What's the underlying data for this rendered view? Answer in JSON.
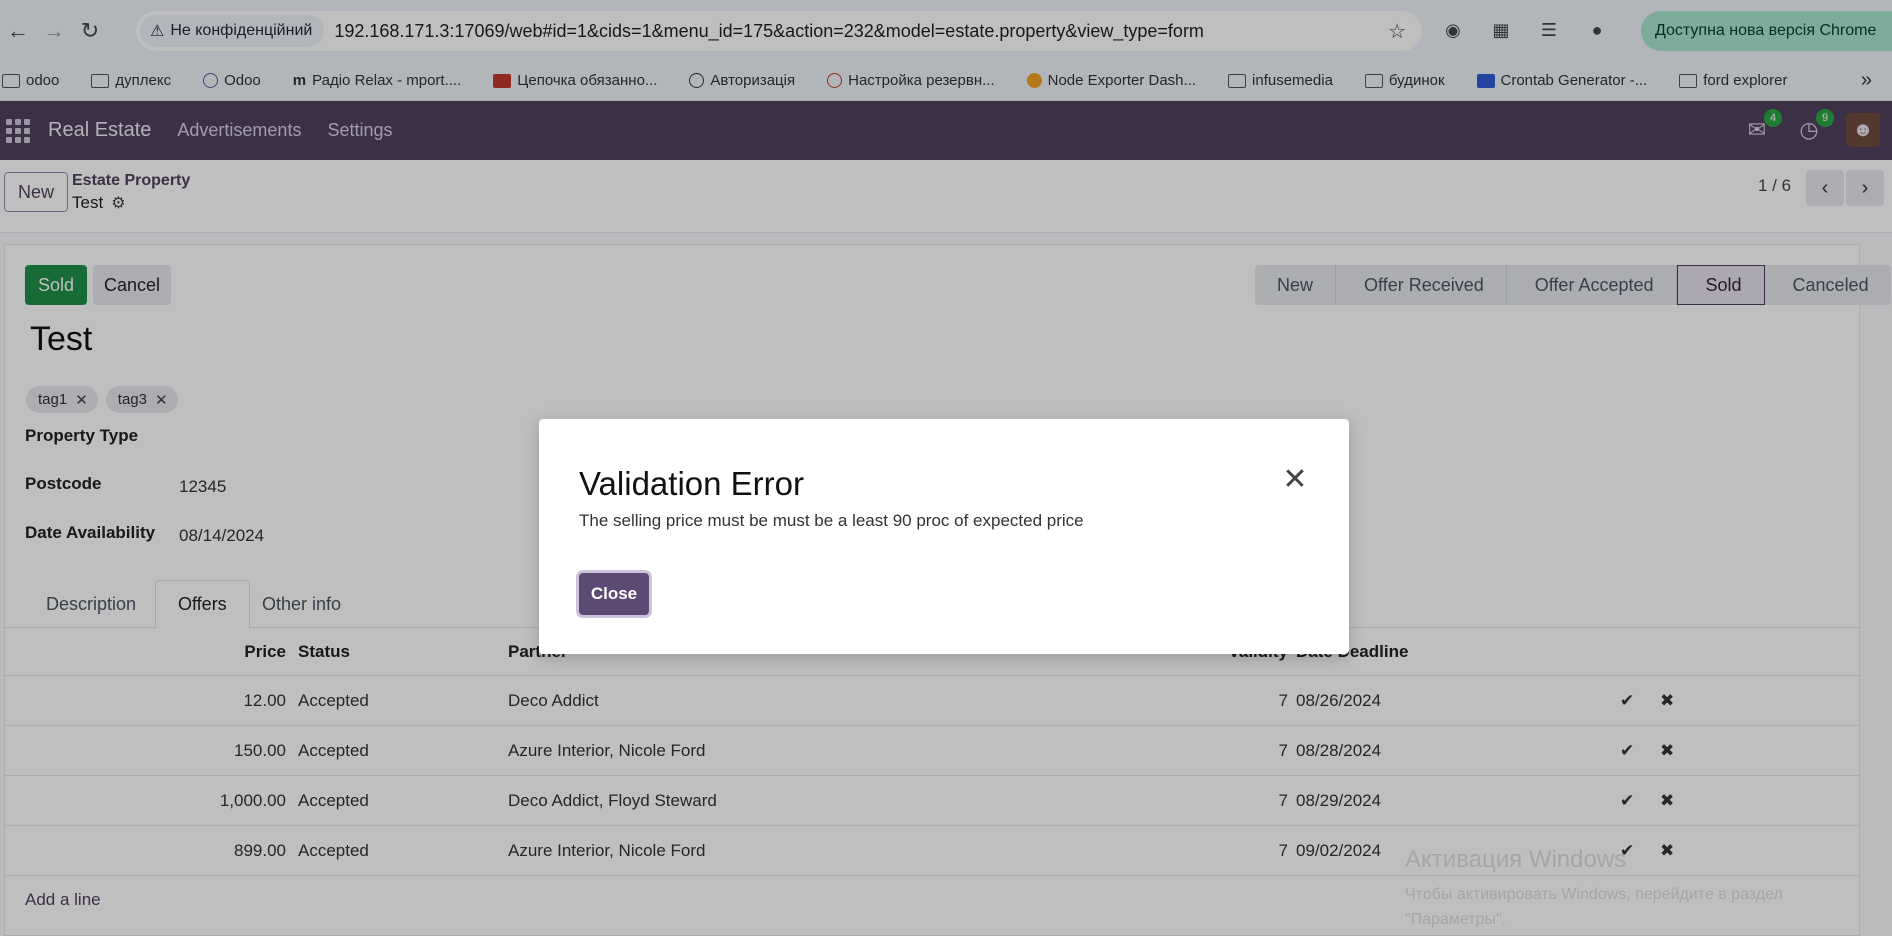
{
  "browser": {
    "security_label": "Не конфіденційний",
    "url": "192.168.171.3:17069/web#id=1&cids=1&menu_id=175&action=232&model=estate.property&view_type=form",
    "update_label": "Доступна нова версія Chrome",
    "bookmarks": [
      "odoo",
      "дуплекс",
      "Odoo",
      "Радіо Relax - mport....",
      "Цепочка обязанно...",
      "Авторизація",
      "Настройка резервн...",
      "Node Exporter Dash...",
      "infusemedia",
      "будинок",
      "Crontab Generator -...",
      "ford explorer"
    ]
  },
  "navbar": {
    "brand": "Real Estate",
    "menu": [
      "Advertisements",
      "Settings"
    ],
    "messages_count": "4",
    "activities_count": "9"
  },
  "control": {
    "new_label": "New",
    "breadcrumb_parent": "Estate Property",
    "breadcrumb_current": "Test",
    "pager": "1 / 6"
  },
  "form": {
    "sold_label": "Sold",
    "cancel_label": "Cancel",
    "stages": [
      "New",
      "Offer Received",
      "Offer Accepted",
      "Sold",
      "Canceled"
    ],
    "current_stage": "Sold",
    "title": "Test",
    "tags": [
      "tag1",
      "tag3"
    ],
    "fields": {
      "property_type_label": "Property Type",
      "postcode_label": "Postcode",
      "postcode_value": "12345",
      "date_label": "Date Availability",
      "date_value": "08/14/2024"
    },
    "tabs": [
      "Description",
      "Offers",
      "Other info"
    ],
    "active_tab": "Offers",
    "columns": {
      "price": "Price",
      "status": "Status",
      "partner": "Partner",
      "validity": "Validity",
      "deadline": "Date Deadline"
    },
    "offers": [
      {
        "price": "12.00",
        "status": "Accepted",
        "partner": "Deco Addict",
        "validity": "7",
        "deadline": "08/26/2024"
      },
      {
        "price": "150.00",
        "status": "Accepted",
        "partner": "Azure Interior, Nicole Ford",
        "validity": "7",
        "deadline": "08/28/2024"
      },
      {
        "price": "1,000.00",
        "status": "Accepted",
        "partner": "Deco Addict, Floyd Steward",
        "validity": "7",
        "deadline": "08/29/2024"
      },
      {
        "price": "899.00",
        "status": "Accepted",
        "partner": "Azure Interior, Nicole Ford",
        "validity": "7",
        "deadline": "09/02/2024"
      }
    ],
    "add_line": "Add a line"
  },
  "dialog": {
    "title": "Validation Error",
    "message": "The selling price must be must be a least 90 proc of expected price",
    "close_label": "Close"
  },
  "watermark": {
    "line1": "Активация Windows",
    "line2": "Чтобы активировать Windows, перейдите в раздел",
    "line3": "\"Параметры\"."
  },
  "colors": {
    "navbar": "#50405f",
    "primary": "#5c4a72",
    "success": "#1e8f4a"
  }
}
